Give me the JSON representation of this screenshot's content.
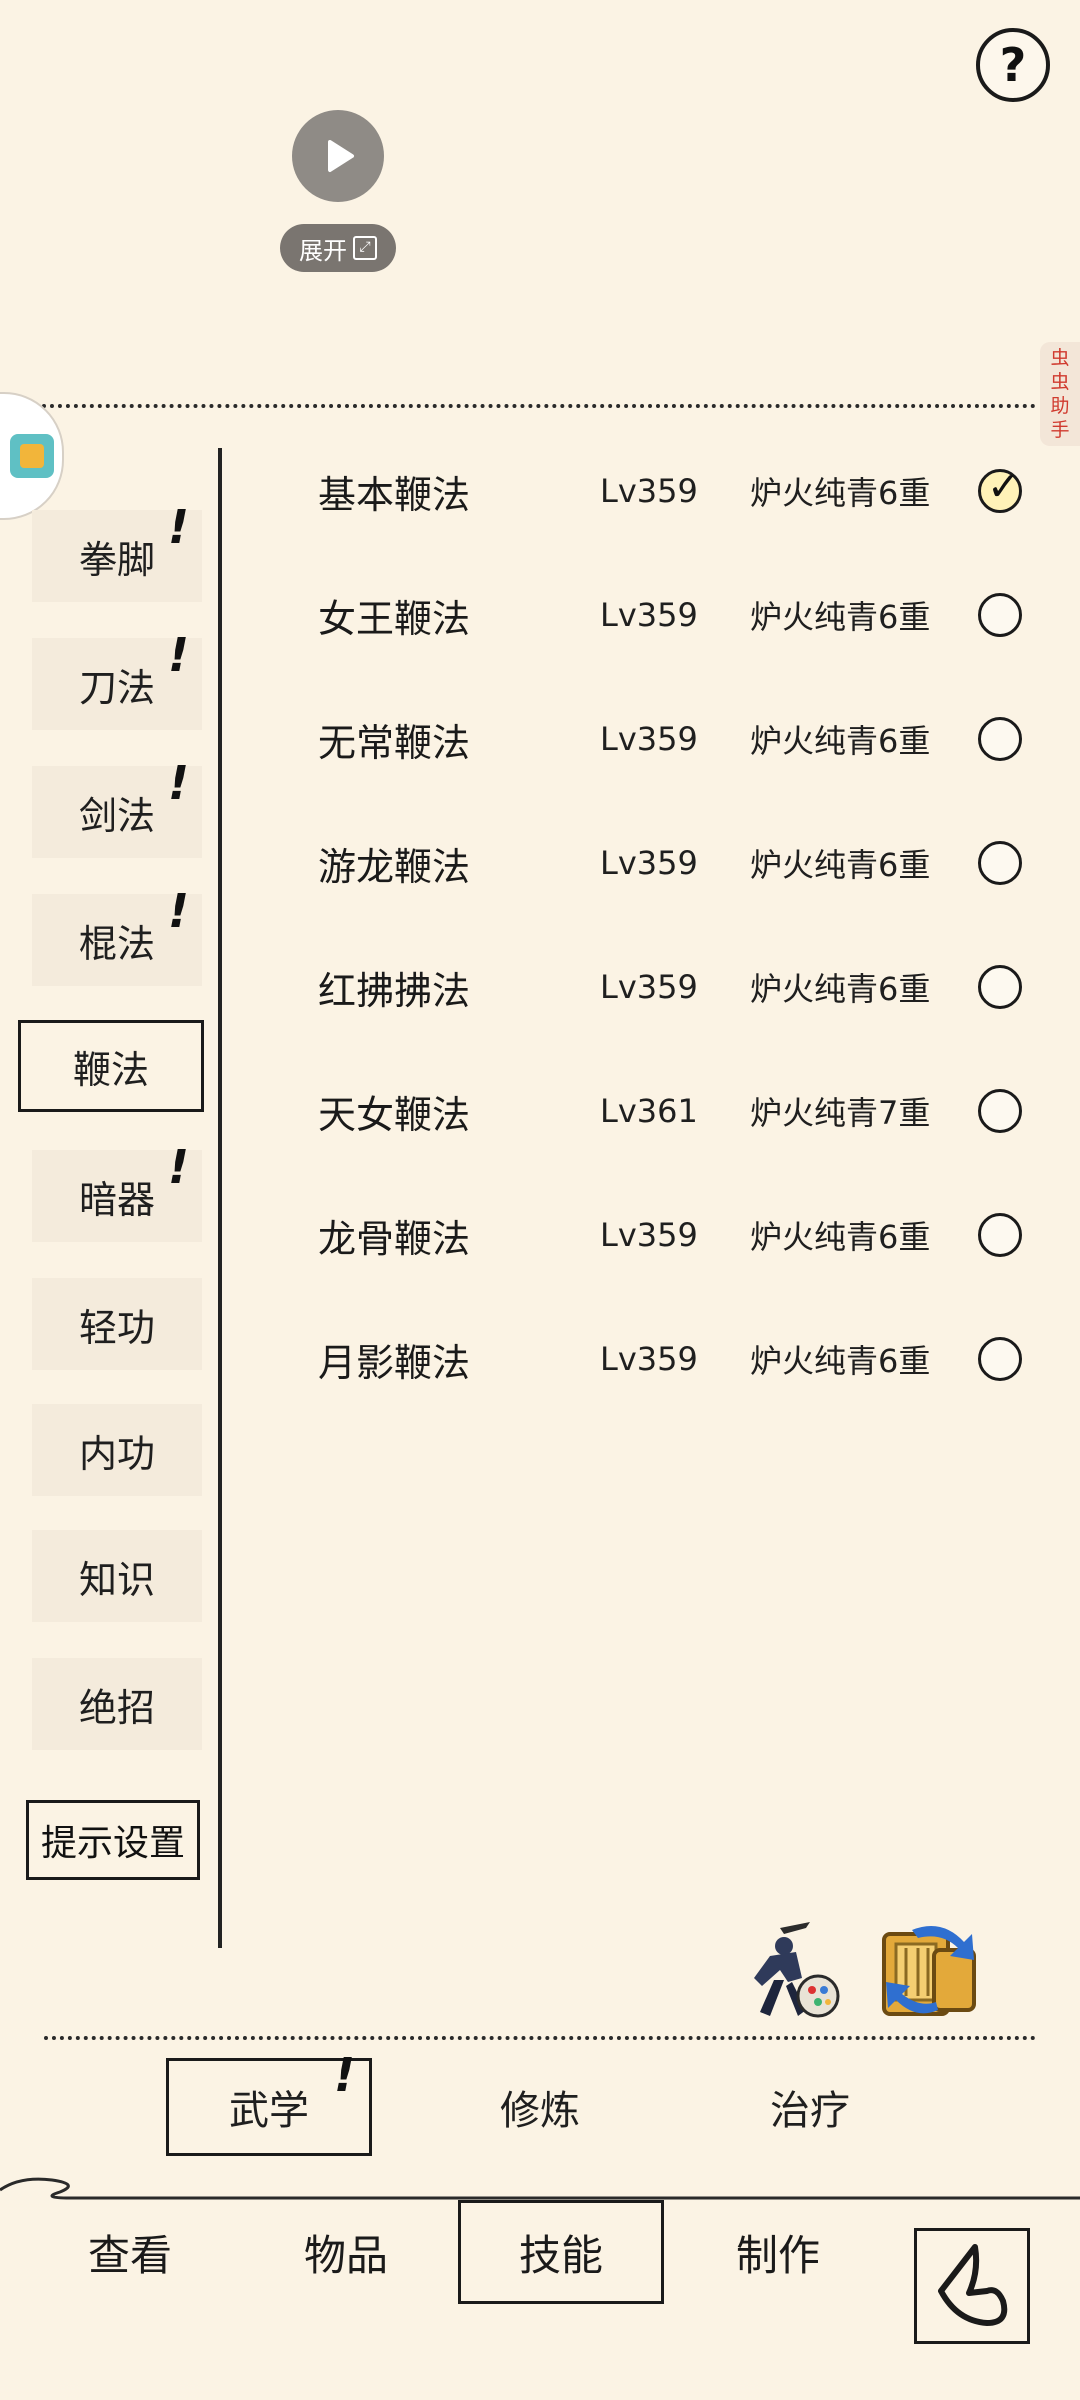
{
  "top": {
    "help_label": "?",
    "expand_label": "展开",
    "helper_tab_chars": [
      "虫",
      "虫",
      "助",
      "手"
    ]
  },
  "categories": [
    {
      "label": "拳脚",
      "has_alert": true,
      "active": false
    },
    {
      "label": "刀法",
      "has_alert": true,
      "active": false
    },
    {
      "label": "剑法",
      "has_alert": true,
      "active": false
    },
    {
      "label": "棍法",
      "has_alert": true,
      "active": false
    },
    {
      "label": "鞭法",
      "has_alert": false,
      "active": true
    },
    {
      "label": "暗器",
      "has_alert": true,
      "active": false
    },
    {
      "label": "轻功",
      "has_alert": false,
      "active": false
    },
    {
      "label": "内功",
      "has_alert": false,
      "active": false
    },
    {
      "label": "知识",
      "has_alert": false,
      "active": false
    },
    {
      "label": "绝招",
      "has_alert": false,
      "active": false
    }
  ],
  "alert_mark": "!",
  "hint_settings_label": "提示设置",
  "skills": [
    {
      "name": "基本鞭法",
      "level": "Lv359",
      "rank": "炉火纯青6重",
      "selected": true
    },
    {
      "name": "女王鞭法",
      "level": "Lv359",
      "rank": "炉火纯青6重",
      "selected": false
    },
    {
      "name": "无常鞭法",
      "level": "Lv359",
      "rank": "炉火纯青6重",
      "selected": false
    },
    {
      "name": "游龙鞭法",
      "level": "Lv359",
      "rank": "炉火纯青6重",
      "selected": false
    },
    {
      "name": "红拂拂法",
      "level": "Lv359",
      "rank": "炉火纯青6重",
      "selected": false
    },
    {
      "name": "天女鞭法",
      "level": "Lv361",
      "rank": "炉火纯青7重",
      "selected": false
    },
    {
      "name": "龙骨鞭法",
      "level": "Lv359",
      "rank": "炉火纯青6重",
      "selected": false
    },
    {
      "name": "月影鞭法",
      "level": "Lv359",
      "rank": "炉火纯青6重",
      "selected": false
    }
  ],
  "checkmark": "✓",
  "subtabs": {
    "martial": "武学",
    "cultivate": "修炼",
    "heal": "治疗"
  },
  "nav": {
    "view": "查看",
    "items": "物品",
    "skills": "技能",
    "craft": "制作"
  }
}
